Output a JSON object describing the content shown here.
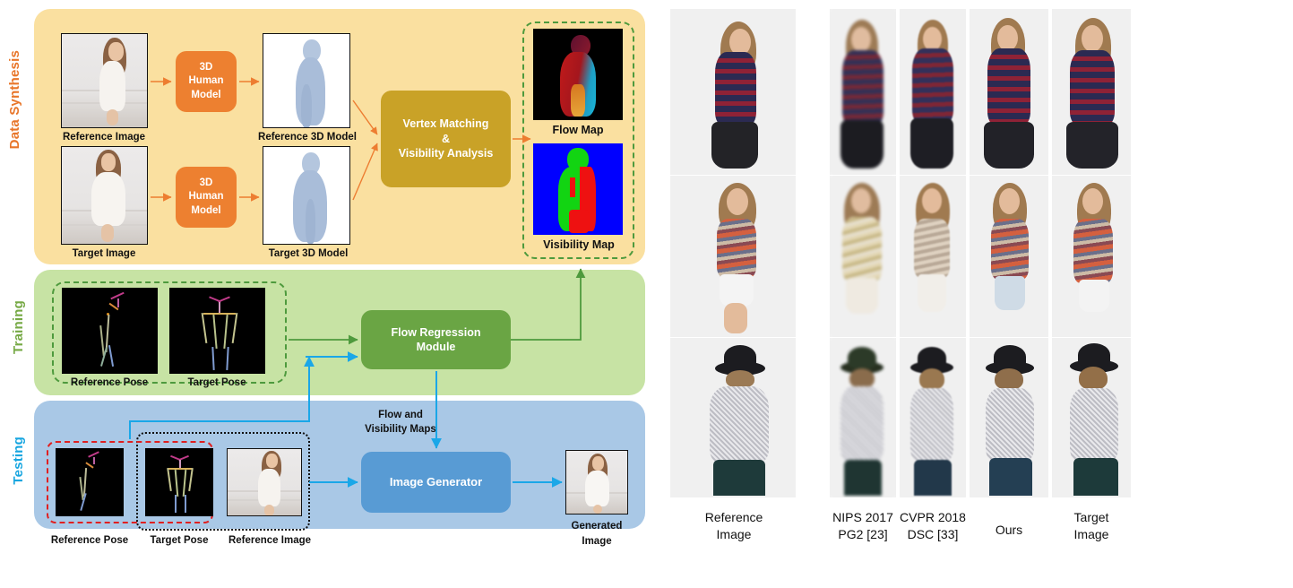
{
  "pipeline": {
    "stages": [
      {
        "key": "data_synthesis",
        "label": "Data Synthesis"
      },
      {
        "key": "training",
        "label": "Training"
      },
      {
        "key": "testing",
        "label": "Testing"
      }
    ],
    "data_synthesis": {
      "label": "Data Synthesis",
      "captions": {
        "reference_image": "Reference Image",
        "target_image": "Target Image",
        "reference_3d_model": "Reference 3D Model",
        "target_3d_model": "Target 3D Model",
        "flow_map": "Flow Map",
        "visibility_map": "Visibility Map"
      },
      "boxes": {
        "human_model_top": "3D\nHuman\nModel",
        "human_model_bottom": "3D\nHuman\nModel",
        "vertex_matching": "Vertex Matching\n&\nVisibility Analysis"
      }
    },
    "training": {
      "label": "Training",
      "captions": {
        "reference_pose": "Reference Pose",
        "target_pose": "Target Pose"
      },
      "boxes": {
        "flow_regression": "Flow Regression\nModule"
      }
    },
    "testing": {
      "label": "Testing",
      "captions": {
        "reference_pose": "Reference Pose",
        "target_pose": "Target Pose",
        "reference_image": "Reference Image",
        "generated_image": "Generated\nImage"
      },
      "boxes": {
        "image_generator": "Image Generator"
      },
      "edge_labels": {
        "flow_and_visibility_maps": "Flow and\nVisibility Maps"
      }
    },
    "colors": {
      "synthesis_panel": "#fae0a0",
      "training_panel": "#c7e3a4",
      "testing_panel": "#a9c8e6",
      "synthesis_label": "#e8762a",
      "training_label": "#76a945",
      "testing_label": "#18a6e0",
      "orange_box": "#ed8030",
      "gold_box": "#c9a227",
      "green_box": "#6aa544",
      "blue_box": "#589bd4",
      "orange_arrow": "#ed7d31",
      "green_arrow": "#4e9a3d",
      "blue_arrow": "#1aa7e8",
      "red_dash": "#e02020",
      "black_dot": "#111111"
    }
  },
  "comparison": {
    "columns": [
      {
        "key": "reference",
        "label": "Reference\nImage"
      },
      {
        "key": "pg2",
        "label": "NIPS 2017\nPG2 [23]"
      },
      {
        "key": "dsc",
        "label": "CVPR 2018\nDSC [33]"
      },
      {
        "key": "ours",
        "label": "Ours"
      },
      {
        "key": "target",
        "label": "Target\nImage"
      }
    ],
    "rows": [
      {
        "key": "row_striped_dress",
        "subject": "striped sweater with pleated skirt"
      },
      {
        "key": "row_print_tank",
        "subject": "printed tank top with white shorts"
      },
      {
        "key": "row_knit_hat",
        "subject": "grey knit sweater with black hat"
      }
    ]
  }
}
